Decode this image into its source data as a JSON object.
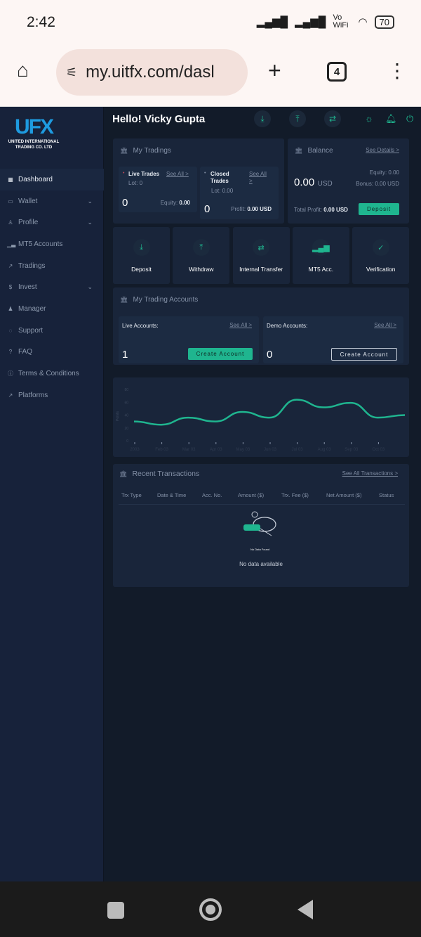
{
  "status_bar": {
    "time": "2:42",
    "network": "Vo WiFi",
    "battery": "70"
  },
  "browser": {
    "url": "my.uitfx.com/dasl",
    "tab_count": "4"
  },
  "logo": {
    "mark": "UFX",
    "line1": "UNITED INTERNATIONAL",
    "line2": "TRADING CO. LTD"
  },
  "sidebar": {
    "items": [
      {
        "label": "Dashboard",
        "icon": "grid-icon",
        "chevron": false
      },
      {
        "label": "Wallet",
        "icon": "wallet-icon",
        "chevron": true
      },
      {
        "label": "Profile",
        "icon": "user-icon",
        "chevron": true
      },
      {
        "label": "MT5 Accounts",
        "icon": "signal-icon",
        "chevron": false
      },
      {
        "label": "Tradings",
        "icon": "trend-icon",
        "chevron": false
      },
      {
        "label": "Invest",
        "icon": "dollar-icon",
        "chevron": true
      },
      {
        "label": "Manager",
        "icon": "manager-icon",
        "chevron": false
      },
      {
        "label": "Support",
        "icon": "chat-icon",
        "chevron": false
      },
      {
        "label": "FAQ",
        "icon": "question-icon",
        "chevron": false
      },
      {
        "label": "Terms & Conditions",
        "icon": "info-icon",
        "chevron": false
      },
      {
        "label": "Platforms",
        "icon": "trend-icon",
        "chevron": false
      }
    ]
  },
  "header": {
    "greeting": "Hello! Vicky Gupta"
  },
  "my_tradings": {
    "title": "My Tradings",
    "live": {
      "label": "Live Trades",
      "see_all": "See All >",
      "lot": "Lot: 0",
      "count": "0",
      "equity_label": "Equity:",
      "equity": "0.00"
    },
    "closed": {
      "label1": "Closed",
      "label2": "Trades",
      "see_all1": "See All",
      "see_all2": ">",
      "lot": "Lot: 0.00",
      "count": "0",
      "profit_label": "Profit:",
      "profit": "0.00 USD"
    }
  },
  "balance": {
    "title": "Balance",
    "see_details": "See Details >",
    "amount": "0.00",
    "currency": "USD",
    "equity": "Equity: 0.00",
    "bonus": "Bonus: 0.00 USD",
    "total_profit_label": "Total Profit:",
    "total_profit": "0.00 USD",
    "deposit": "Deposit"
  },
  "quick_actions": [
    {
      "label": "Deposit",
      "icon": "⤓"
    },
    {
      "label": "Withdraw",
      "icon": "⤒"
    },
    {
      "label": "Internal Transfer",
      "icon": "⇄"
    },
    {
      "label": "MT5 Acc.",
      "icon": "▂▄▆"
    },
    {
      "label": "Verification",
      "icon": "✓"
    }
  ],
  "trading_accounts": {
    "title": "My Trading Accounts",
    "live": {
      "label": "Live Accounts:",
      "see_all": "See All >",
      "count": "1",
      "button": "Create Account"
    },
    "demo": {
      "label": "Demo Accounts:",
      "see_all": "See All >",
      "count": "0",
      "button": "Create Account"
    }
  },
  "chart_data": {
    "type": "line",
    "ylabel": "Points",
    "ylim": [
      0,
      80
    ],
    "yticks": [
      "0",
      "20",
      "40",
      "60",
      "80"
    ],
    "x_labels": [
      "2003",
      "Feb 03",
      "Mar 03",
      "Apr 03",
      "May 03",
      "Jun 03",
      "Jul 03",
      "Aug 03",
      "Sep 03",
      "Oct 03"
    ],
    "values": [
      30,
      25,
      36,
      30,
      45,
      36,
      64,
      52,
      59,
      36,
      40
    ],
    "color": "#1fb58f"
  },
  "transactions": {
    "title": "Recent Transactions",
    "see_all": "See All Transactions >",
    "columns": [
      "Trx Type",
      "Date & Time",
      "Acc. No.",
      "Amount ($)",
      "Trx. Fee ($)",
      "Net Amount ($)",
      "Status"
    ],
    "illustration_caption": "No Data Found",
    "empty": "No data available"
  }
}
